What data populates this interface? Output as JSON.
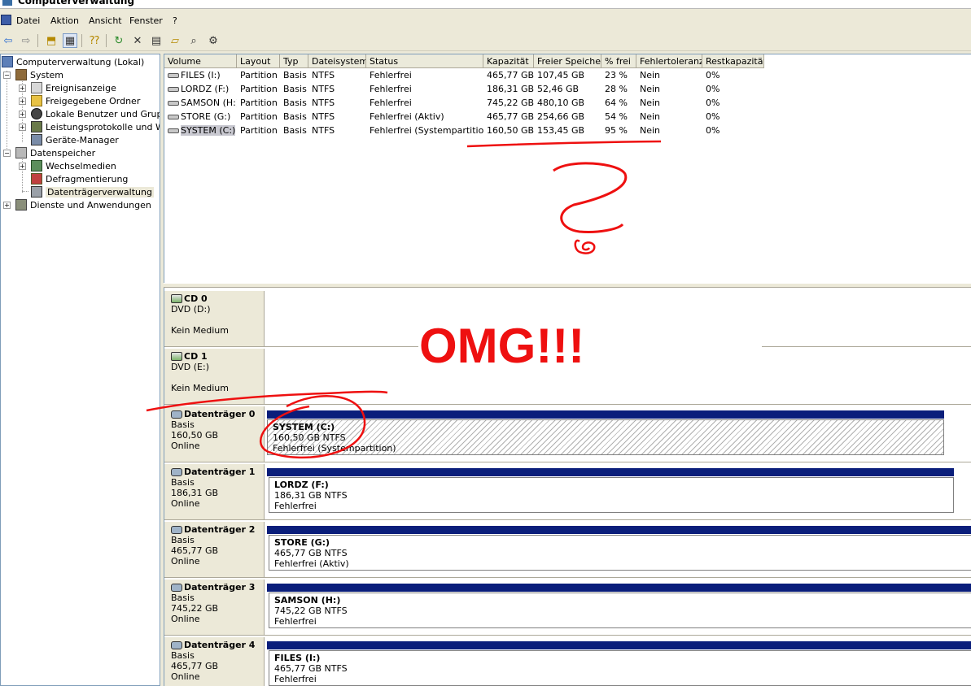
{
  "window": {
    "title": "Computerverwaltung"
  },
  "menu": [
    "Datei",
    "Aktion",
    "Ansicht",
    "Fenster",
    "?"
  ],
  "toolbar": [
    "back-arrow-icon",
    "forward-arrow-icon",
    "up-folder-icon",
    "show-tree-icon",
    "help-icon",
    "refresh-icon",
    "delete-icon",
    "properties-icon",
    "open-icon",
    "search-icon",
    "settings-icon"
  ],
  "tree": {
    "root": "Computerverwaltung (Lokal)",
    "system": "System",
    "system_children": [
      "Ereignisanzeige",
      "Freigegebene Ordner",
      "Lokale Benutzer und Gruppen",
      "Leistungsprotokolle und Warnungen",
      "Geräte-Manager"
    ],
    "storage": "Datenspeicher",
    "storage_children": [
      "Wechselmedien",
      "Defragmentierung",
      "Datenträgerverwaltung"
    ],
    "services": "Dienste und Anwendungen"
  },
  "volumes": {
    "columns": [
      "Volume",
      "Layout",
      "Typ",
      "Dateisystem",
      "Status",
      "Kapazität",
      "Freier Speicher",
      "% frei",
      "Fehlertoleranz",
      "Restkapazität"
    ],
    "rows": [
      [
        "FILES (I:)",
        "Partition",
        "Basis",
        "NTFS",
        "Fehlerfrei",
        "465,77 GB",
        "107,45 GB",
        "23 %",
        "Nein",
        "0%"
      ],
      [
        "LORDZ (F:)",
        "Partition",
        "Basis",
        "NTFS",
        "Fehlerfrei",
        "186,31 GB",
        "52,46 GB",
        "28 %",
        "Nein",
        "0%"
      ],
      [
        "SAMSON (H:)",
        "Partition",
        "Basis",
        "NTFS",
        "Fehlerfrei",
        "745,22 GB",
        "480,10 GB",
        "64 %",
        "Nein",
        "0%"
      ],
      [
        "STORE (G:)",
        "Partition",
        "Basis",
        "NTFS",
        "Fehlerfrei (Aktiv)",
        "465,77 GB",
        "254,66 GB",
        "54 %",
        "Nein",
        "0%"
      ],
      [
        "SYSTEM (C:)",
        "Partition",
        "Basis",
        "NTFS",
        "Fehlerfrei (Systempartition)",
        "160,50 GB",
        "153,45 GB",
        "95 %",
        "Nein",
        "0%"
      ]
    ]
  },
  "disks": [
    {
      "name": "CD 0",
      "line1": "DVD (D:)",
      "line2": "",
      "line3": "Kein Medium",
      "kind": "cd"
    },
    {
      "name": "CD 1",
      "line1": "DVD (E:)",
      "line2": "",
      "line3": "Kein Medium",
      "kind": "cd"
    },
    {
      "name": "Datenträger 0",
      "line1": "Basis",
      "line2": "160,50 GB",
      "line3": "Online",
      "kind": "disk",
      "partition": {
        "name": "SYSTEM  (C:)",
        "size": "160,50 GB NTFS",
        "status": "Fehlerfrei (Systempartition)"
      }
    },
    {
      "name": "Datenträger 1",
      "line1": "Basis",
      "line2": "186,31 GB",
      "line3": "Online",
      "kind": "disk",
      "partition": {
        "name": "LORDZ  (F:)",
        "size": "186,31 GB NTFS",
        "status": "Fehlerfrei"
      }
    },
    {
      "name": "Datenträger 2",
      "line1": "Basis",
      "line2": "465,77 GB",
      "line3": "Online",
      "kind": "disk",
      "partition": {
        "name": "STORE  (G:)",
        "size": "465,77 GB NTFS",
        "status": "Fehlerfrei (Aktiv)"
      }
    },
    {
      "name": "Datenträger 3",
      "line1": "Basis",
      "line2": "745,22 GB",
      "line3": "Online",
      "kind": "disk",
      "partition": {
        "name": "SAMSON  (H:)",
        "size": "745,22 GB NTFS",
        "status": "Fehlerfrei"
      }
    },
    {
      "name": "Datenträger 4",
      "line1": "Basis",
      "line2": "465,77 GB",
      "line3": "Online",
      "kind": "disk",
      "partition": {
        "name": "FILES  (I:)",
        "size": "465,77 GB NTFS",
        "status": "Fehlerfrei"
      }
    }
  ],
  "annotations": {
    "omg": "OMG!!!",
    "annotation_color": "#ee1010"
  }
}
